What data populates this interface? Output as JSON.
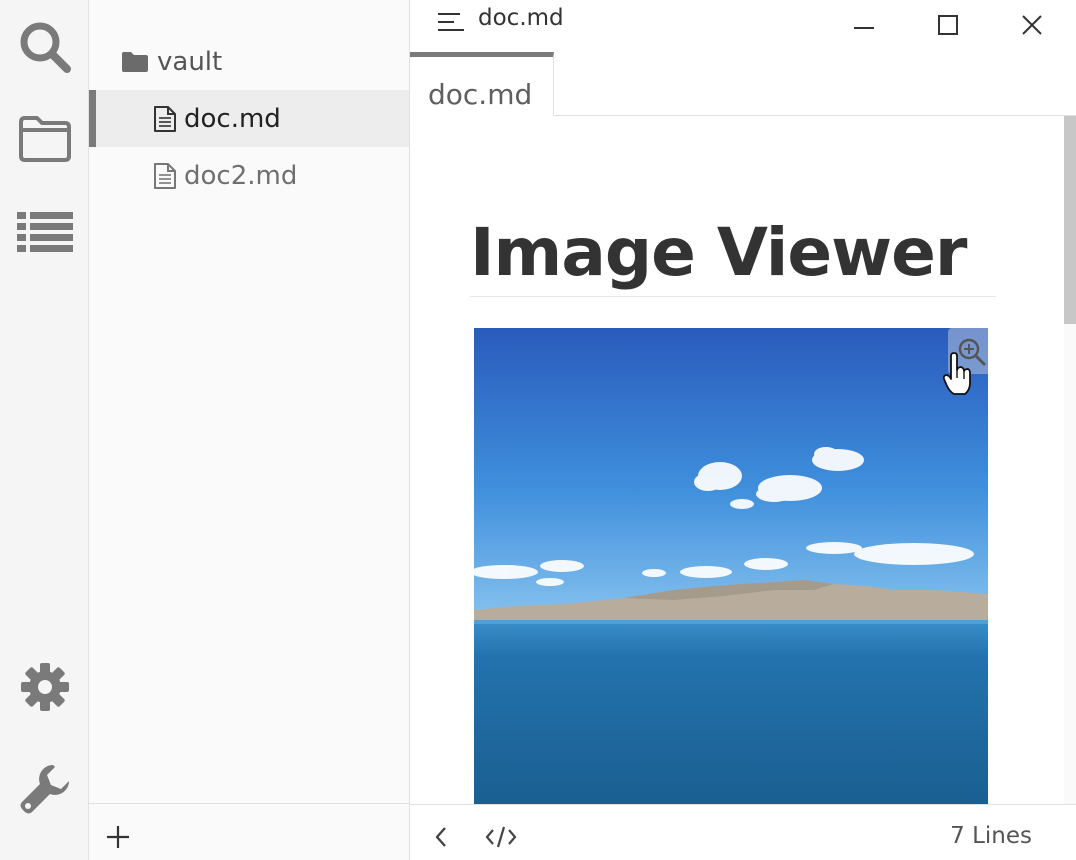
{
  "sidebar": {
    "vault_label": "vault",
    "files": [
      "doc.md",
      "doc2.md"
    ]
  },
  "titlebar": {
    "title": "doc.md"
  },
  "tab": {
    "label": "doc.md"
  },
  "document": {
    "heading": "Image Viewer"
  },
  "statusbar": {
    "line_count": "7 Lines"
  },
  "icons": {
    "activity": [
      "search-icon",
      "folder-icon",
      "outline-list-icon",
      "settings-gear-icon",
      "wrench-icon"
    ],
    "window": [
      "minimize-icon",
      "maximize-icon",
      "close-icon"
    ]
  },
  "colors": {
    "icon": "#7a7a7a",
    "active_marker": "#7a7a7a",
    "sky_top": "#2a5bbd",
    "sea": "#1e6ea6"
  }
}
